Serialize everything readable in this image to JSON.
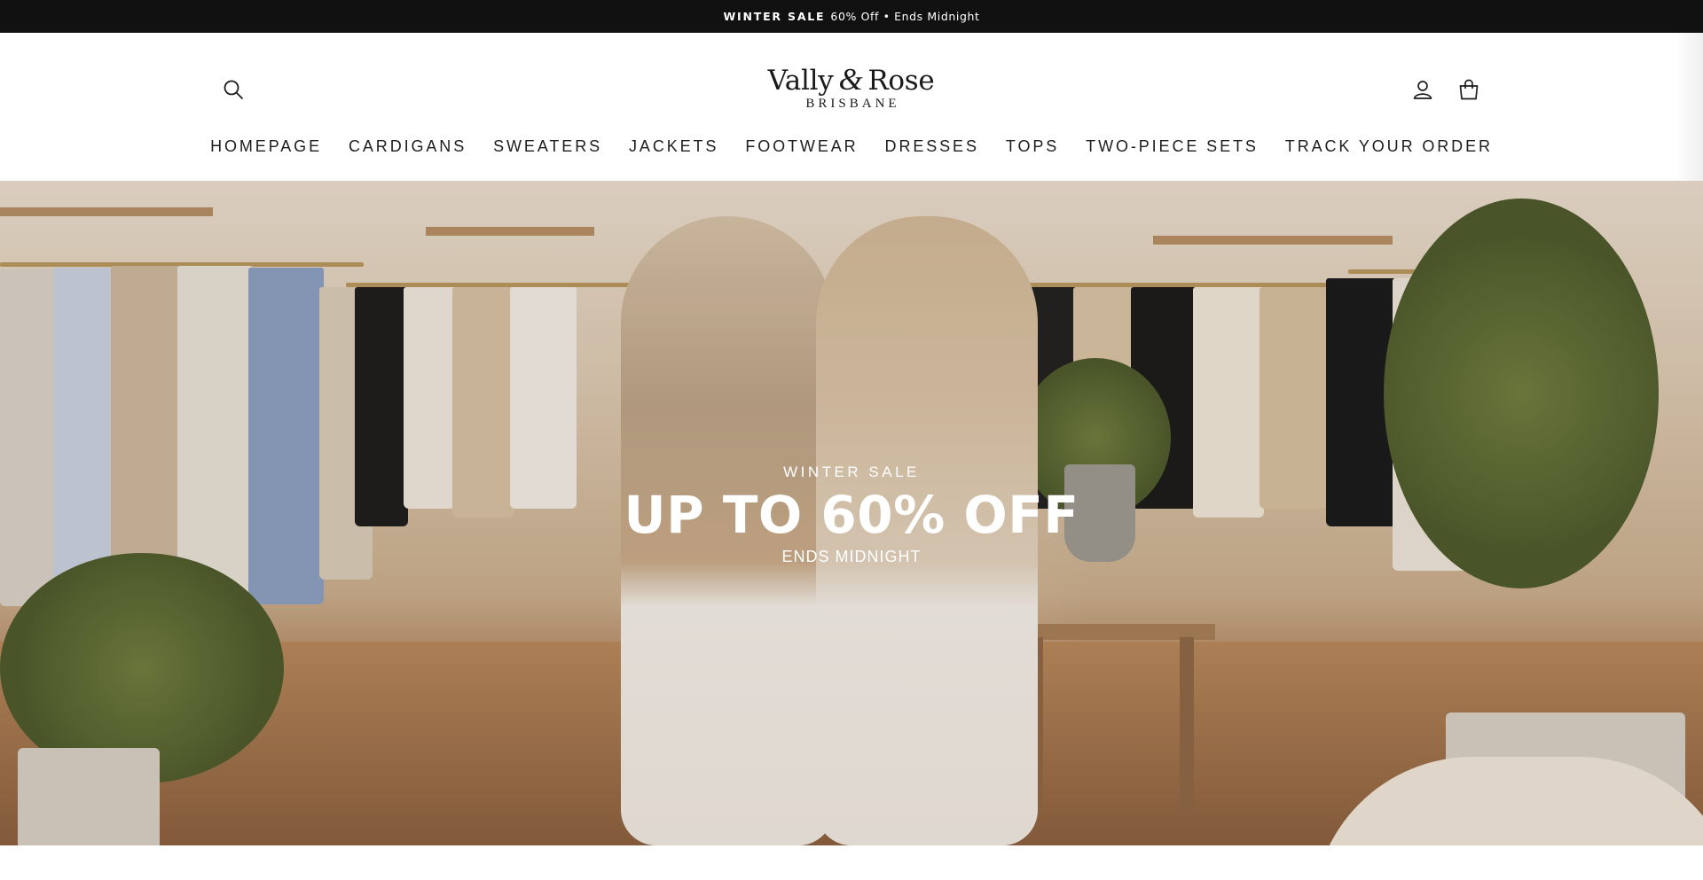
{
  "announcement": {
    "strong": "WINTER SALE",
    "text": "60% Off • Ends Midnight"
  },
  "header": {
    "logo_name_part1": "Vally",
    "logo_amp": "&",
    "logo_name_part2": "Rose",
    "logo_sub": "BRISBANE"
  },
  "icons": {
    "search": "search-icon",
    "account": "user-icon",
    "cart": "shopping-bag-icon"
  },
  "nav": {
    "items": [
      {
        "label": "HOMEPAGE"
      },
      {
        "label": "CARDIGANS"
      },
      {
        "label": "SWEATERS"
      },
      {
        "label": "JACKETS"
      },
      {
        "label": "FOOTWEAR"
      },
      {
        "label": "DRESSES"
      },
      {
        "label": "TOPS"
      },
      {
        "label": "TWO-PIECE SETS"
      },
      {
        "label": "TRACK YOUR ORDER"
      }
    ]
  },
  "hero": {
    "kicker": "WINTER SALE",
    "title": "UP TO 60% OFF",
    "subtitle": "ENDS MIDNIGHT"
  },
  "colors": {
    "announcement_bg": "#111111",
    "text": "#1c1d1d",
    "hero_text": "#ffffff"
  }
}
